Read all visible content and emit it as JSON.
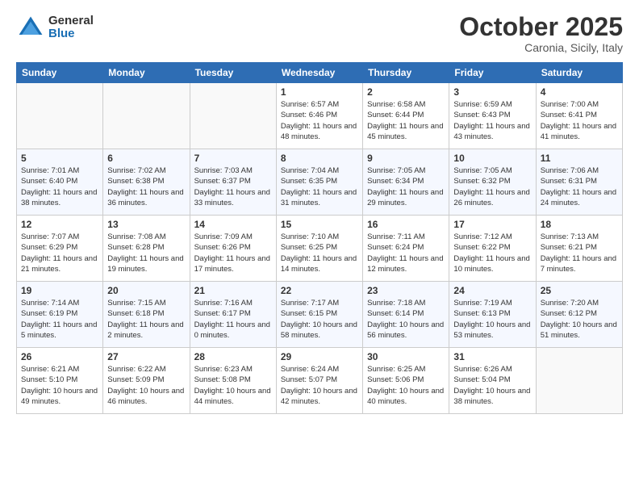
{
  "header": {
    "logo_general": "General",
    "logo_blue": "Blue",
    "month_title": "October 2025",
    "subtitle": "Caronia, Sicily, Italy"
  },
  "days_of_week": [
    "Sunday",
    "Monday",
    "Tuesday",
    "Wednesday",
    "Thursday",
    "Friday",
    "Saturday"
  ],
  "weeks": [
    [
      {
        "day": "",
        "info": ""
      },
      {
        "day": "",
        "info": ""
      },
      {
        "day": "",
        "info": ""
      },
      {
        "day": "1",
        "info": "Sunrise: 6:57 AM\nSunset: 6:46 PM\nDaylight: 11 hours\nand 48 minutes."
      },
      {
        "day": "2",
        "info": "Sunrise: 6:58 AM\nSunset: 6:44 PM\nDaylight: 11 hours\nand 45 minutes."
      },
      {
        "day": "3",
        "info": "Sunrise: 6:59 AM\nSunset: 6:43 PM\nDaylight: 11 hours\nand 43 minutes."
      },
      {
        "day": "4",
        "info": "Sunrise: 7:00 AM\nSunset: 6:41 PM\nDaylight: 11 hours\nand 41 minutes."
      }
    ],
    [
      {
        "day": "5",
        "info": "Sunrise: 7:01 AM\nSunset: 6:40 PM\nDaylight: 11 hours\nand 38 minutes."
      },
      {
        "day": "6",
        "info": "Sunrise: 7:02 AM\nSunset: 6:38 PM\nDaylight: 11 hours\nand 36 minutes."
      },
      {
        "day": "7",
        "info": "Sunrise: 7:03 AM\nSunset: 6:37 PM\nDaylight: 11 hours\nand 33 minutes."
      },
      {
        "day": "8",
        "info": "Sunrise: 7:04 AM\nSunset: 6:35 PM\nDaylight: 11 hours\nand 31 minutes."
      },
      {
        "day": "9",
        "info": "Sunrise: 7:05 AM\nSunset: 6:34 PM\nDaylight: 11 hours\nand 29 minutes."
      },
      {
        "day": "10",
        "info": "Sunrise: 7:05 AM\nSunset: 6:32 PM\nDaylight: 11 hours\nand 26 minutes."
      },
      {
        "day": "11",
        "info": "Sunrise: 7:06 AM\nSunset: 6:31 PM\nDaylight: 11 hours\nand 24 minutes."
      }
    ],
    [
      {
        "day": "12",
        "info": "Sunrise: 7:07 AM\nSunset: 6:29 PM\nDaylight: 11 hours\nand 21 minutes."
      },
      {
        "day": "13",
        "info": "Sunrise: 7:08 AM\nSunset: 6:28 PM\nDaylight: 11 hours\nand 19 minutes."
      },
      {
        "day": "14",
        "info": "Sunrise: 7:09 AM\nSunset: 6:26 PM\nDaylight: 11 hours\nand 17 minutes."
      },
      {
        "day": "15",
        "info": "Sunrise: 7:10 AM\nSunset: 6:25 PM\nDaylight: 11 hours\nand 14 minutes."
      },
      {
        "day": "16",
        "info": "Sunrise: 7:11 AM\nSunset: 6:24 PM\nDaylight: 11 hours\nand 12 minutes."
      },
      {
        "day": "17",
        "info": "Sunrise: 7:12 AM\nSunset: 6:22 PM\nDaylight: 11 hours\nand 10 minutes."
      },
      {
        "day": "18",
        "info": "Sunrise: 7:13 AM\nSunset: 6:21 PM\nDaylight: 11 hours\nand 7 minutes."
      }
    ],
    [
      {
        "day": "19",
        "info": "Sunrise: 7:14 AM\nSunset: 6:19 PM\nDaylight: 11 hours\nand 5 minutes."
      },
      {
        "day": "20",
        "info": "Sunrise: 7:15 AM\nSunset: 6:18 PM\nDaylight: 11 hours\nand 2 minutes."
      },
      {
        "day": "21",
        "info": "Sunrise: 7:16 AM\nSunset: 6:17 PM\nDaylight: 11 hours\nand 0 minutes."
      },
      {
        "day": "22",
        "info": "Sunrise: 7:17 AM\nSunset: 6:15 PM\nDaylight: 10 hours\nand 58 minutes."
      },
      {
        "day": "23",
        "info": "Sunrise: 7:18 AM\nSunset: 6:14 PM\nDaylight: 10 hours\nand 56 minutes."
      },
      {
        "day": "24",
        "info": "Sunrise: 7:19 AM\nSunset: 6:13 PM\nDaylight: 10 hours\nand 53 minutes."
      },
      {
        "day": "25",
        "info": "Sunrise: 7:20 AM\nSunset: 6:12 PM\nDaylight: 10 hours\nand 51 minutes."
      }
    ],
    [
      {
        "day": "26",
        "info": "Sunrise: 6:21 AM\nSunset: 5:10 PM\nDaylight: 10 hours\nand 49 minutes."
      },
      {
        "day": "27",
        "info": "Sunrise: 6:22 AM\nSunset: 5:09 PM\nDaylight: 10 hours\nand 46 minutes."
      },
      {
        "day": "28",
        "info": "Sunrise: 6:23 AM\nSunset: 5:08 PM\nDaylight: 10 hours\nand 44 minutes."
      },
      {
        "day": "29",
        "info": "Sunrise: 6:24 AM\nSunset: 5:07 PM\nDaylight: 10 hours\nand 42 minutes."
      },
      {
        "day": "30",
        "info": "Sunrise: 6:25 AM\nSunset: 5:06 PM\nDaylight: 10 hours\nand 40 minutes."
      },
      {
        "day": "31",
        "info": "Sunrise: 6:26 AM\nSunset: 5:04 PM\nDaylight: 10 hours\nand 38 minutes."
      },
      {
        "day": "",
        "info": ""
      }
    ]
  ]
}
